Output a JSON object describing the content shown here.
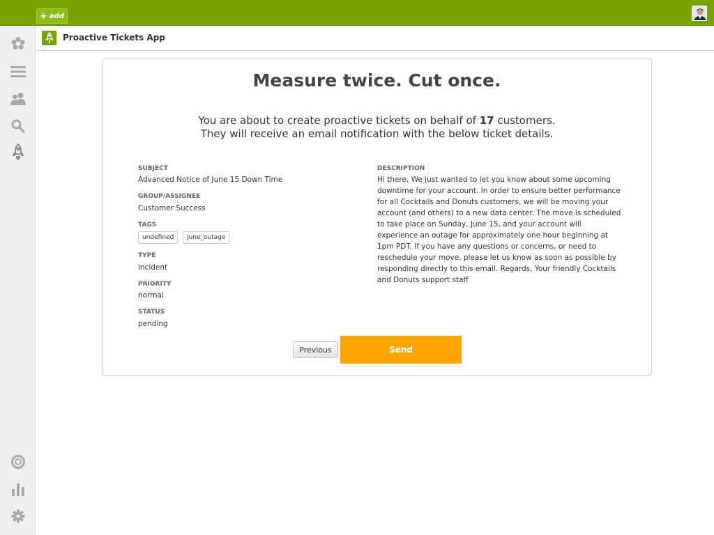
{
  "topbar": {
    "add_label": "add",
    "add_icon": "plus-icon",
    "avatar_icon": "user-avatar"
  },
  "sidebar": {
    "items": [
      {
        "name": "home",
        "icon": "zendesk-logo-icon"
      },
      {
        "name": "views",
        "icon": "menu-icon"
      },
      {
        "name": "users",
        "icon": "users-icon"
      },
      {
        "name": "search",
        "icon": "search-icon"
      },
      {
        "name": "apps",
        "icon": "rocket-icon"
      },
      {
        "name": "help",
        "icon": "lifebuoy-icon"
      },
      {
        "name": "reporting",
        "icon": "bar-chart-icon"
      },
      {
        "name": "admin",
        "icon": "gear-icon"
      }
    ]
  },
  "app": {
    "title": "Proactive Tickets App",
    "icon": "rocket-icon"
  },
  "card": {
    "headline": "Measure twice. Cut once.",
    "intro_before": "You are about to create proactive tickets on behalf of ",
    "intro_count": "17",
    "intro_after": " customers.",
    "intro_line2": "They will receive an email notification with the below ticket details."
  },
  "details": {
    "subject_label": "SUBJECT",
    "subject": "Advanced Notice of June 15 Down Time",
    "group_label": "GROUP/ASSIGNEE",
    "group": "Customer Success",
    "tags_label": "TAGS",
    "tags": [
      "undefined",
      "june_outage"
    ],
    "type_label": "TYPE",
    "type": "incident",
    "priority_label": "PRIORITY",
    "priority": "normal",
    "status_label": "STATUS",
    "status": "pending",
    "description_label": "DESCRIPTION",
    "description": "Hi there, We just wanted to let you know about some upcoming downtime for your account. In order to ensure better performance for all Cocktails and Donuts customers, we will be moving your account (and others) to a new data center. The move is scheduled to take place on Sunday, June 15, and your account will experience an outage for approximately one hour beginning at 1pm PDT. If you have any questions or concerns, or need to reschedule your move, please let us know as soon as possible by responding directly to this email. Regards, Your friendly Cocktails and Donuts support staff"
  },
  "buttons": {
    "previous": "Previous",
    "send": "Send"
  },
  "colors": {
    "topbar": "#78a300",
    "send": "#ffa500",
    "sidebar": "#f0f0f0"
  }
}
